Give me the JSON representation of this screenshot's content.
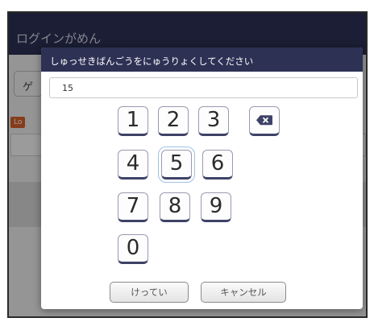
{
  "background": {
    "title": "ログインがめん",
    "button_label": "ゲ",
    "badge_label": "Lo"
  },
  "dialog": {
    "title": "しゅっせきばんごうをにゅうりょくしてください",
    "input_value": "15",
    "keypad": {
      "keys": [
        "1",
        "2",
        "3",
        "4",
        "5",
        "6",
        "7",
        "8",
        "9",
        "0"
      ],
      "backspace_icon": "backspace-icon",
      "focused_key": "5"
    },
    "confirm_label": "けってい",
    "cancel_label": "キャンセル"
  },
  "colors": {
    "header": "#2d3154",
    "key_border": "#3e4266",
    "badge": "#d9622b"
  }
}
